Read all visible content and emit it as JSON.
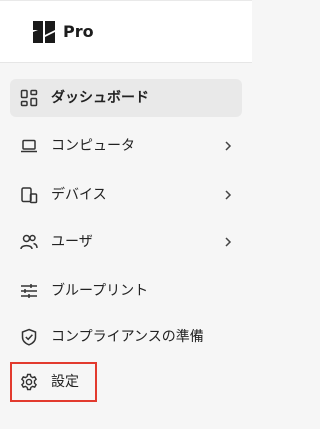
{
  "brand": {
    "name": "Pro",
    "logo_icon": "brand-logo-icon"
  },
  "nav": {
    "items": [
      {
        "label": "ダッシュボード",
        "icon": "grid-icon",
        "active": true,
        "has_submenu": false
      },
      {
        "label": "コンピュータ",
        "icon": "laptop-icon",
        "active": false,
        "has_submenu": true
      },
      {
        "label": "デバイス",
        "icon": "devices-icon",
        "active": false,
        "has_submenu": true
      },
      {
        "label": "ユーザ",
        "icon": "users-icon",
        "active": false,
        "has_submenu": true
      },
      {
        "label": "ブループリント",
        "icon": "sliders-icon",
        "active": false,
        "has_submenu": false
      },
      {
        "label": "コンプライアンスの準備",
        "icon": "shield-check-icon",
        "active": false,
        "has_submenu": false
      },
      {
        "label": "設定",
        "icon": "gear-icon",
        "active": false,
        "has_submenu": false
      }
    ]
  },
  "colors": {
    "highlight_border": "#e23a2e",
    "active_bg": "#e9e9e9",
    "sidebar_bg": "#f6f6f6"
  }
}
